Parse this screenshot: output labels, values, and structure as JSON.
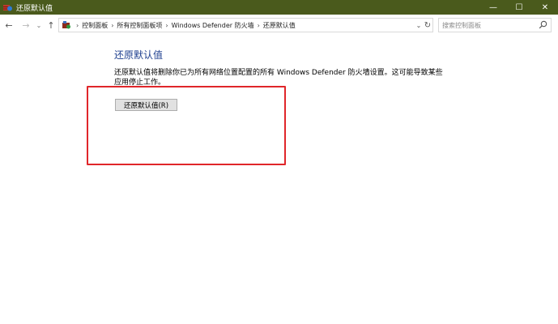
{
  "window": {
    "title": "还原默认值",
    "buttons": {
      "minimize": "—",
      "maximize": "☐",
      "close": "✕"
    }
  },
  "nav": {
    "back": "←",
    "forward": "→",
    "recent": "⌄",
    "up": "↑"
  },
  "breadcrumb": {
    "items": [
      "控制面板",
      "所有控制面板项",
      "Windows Defender 防火墙",
      "还原默认值"
    ],
    "separator": "›",
    "dropdown": "⌄",
    "refresh": "↻"
  },
  "search": {
    "placeholder": "搜索控制面板"
  },
  "main": {
    "heading": "还原默认值",
    "description": "还原默认值将删除你已为所有网络位置配置的所有 Windows Defender 防火墙设置。这可能导致某些应用停止工作。",
    "restore_button": "还原默认值(R)"
  },
  "colors": {
    "titlebar": "#4a5a1c",
    "heading": "#1e3f8f",
    "highlight": "#e0262a"
  }
}
